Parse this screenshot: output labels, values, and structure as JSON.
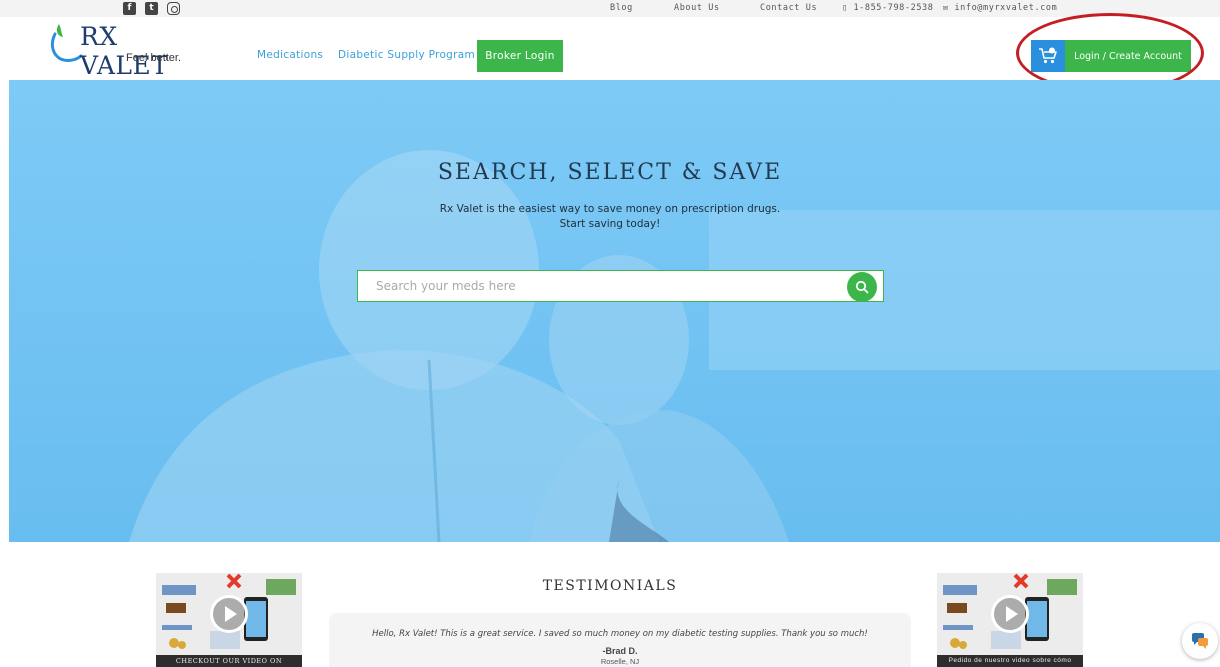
{
  "social": {
    "icons": [
      "facebook-icon",
      "twitter-icon",
      "instagram-icon"
    ]
  },
  "toplinks": {
    "blog": "Blog",
    "about": "About Us",
    "contact": "Contact Us",
    "phone": "1-855-798-2538",
    "email": "info@myrxvalet.com"
  },
  "brand": {
    "name": "RX VALET",
    "tagline": "Feel better."
  },
  "nav": {
    "medications": "Medications",
    "diabetic": "Diabetic Supply Program",
    "broker": "Broker Login",
    "login": "Login / Create Account"
  },
  "hero": {
    "title": "SEARCH, SELECT & SAVE",
    "subtitle_line1": "Rx Valet is the easiest way to save money on prescription drugs.",
    "subtitle_line2": "Start saving today!",
    "search_placeholder": "Search your meds here"
  },
  "videos": {
    "left_caption": "CHECKOUT OUR VIDEO ON",
    "right_caption": "Pedido de nuestro video sobre cómo"
  },
  "testimonials": {
    "title": "TESTIMONIALS",
    "quote": "Hello, Rx Valet! This is a great service. I saved so much money on my diabetic testing supplies. Thank you so much!",
    "author": "-Brad D.",
    "location": "Roselle, NJ"
  },
  "colors": {
    "accent_green": "#3cb64a",
    "accent_blue": "#2a8fdc",
    "hero_blue": "#74c4f4",
    "annotation_red": "#c41e25"
  }
}
